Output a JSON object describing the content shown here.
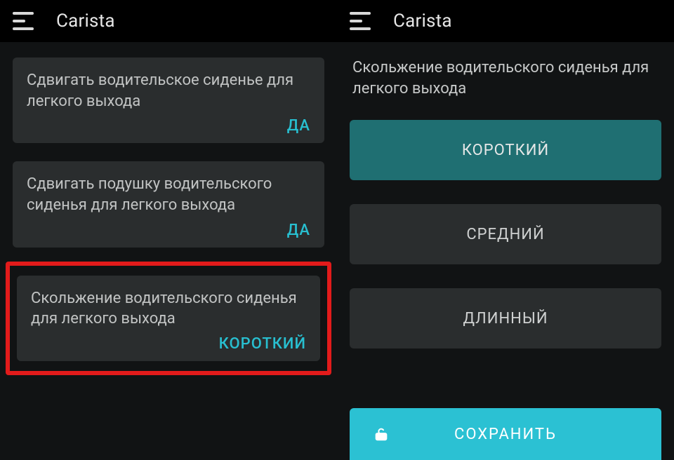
{
  "app": {
    "title": "Carista"
  },
  "left": {
    "settings": [
      {
        "label": "Сдвигать водительское сиденье для легкого выхода",
        "value": "ДА"
      },
      {
        "label": "Сдвигать подушку водительского сиденья для легкого выхода",
        "value": "ДА"
      },
      {
        "label": "Скольжение водительского сиденья для легкого выхода",
        "value": "КОРОТКИЙ"
      }
    ],
    "highlight_index": 2
  },
  "right": {
    "title": "Скольжение водительского сиденья для легкого выхода",
    "options": [
      {
        "label": "КОРОТКИЙ",
        "selected": true
      },
      {
        "label": "СРЕДНИЙ",
        "selected": false
      },
      {
        "label": "ДЛИННЫЙ",
        "selected": false
      }
    ],
    "save_label": "СОХРАНИТЬ"
  },
  "icons": {
    "hamburger": "menu-icon",
    "unlock": "unlock-icon"
  },
  "colors": {
    "accent": "#28bfd0",
    "highlight_border": "#e21b1b",
    "option_bg": "#2a2d2e",
    "option_selected_bg": "#1f6f72",
    "save_bg": "#2bc1d3"
  }
}
